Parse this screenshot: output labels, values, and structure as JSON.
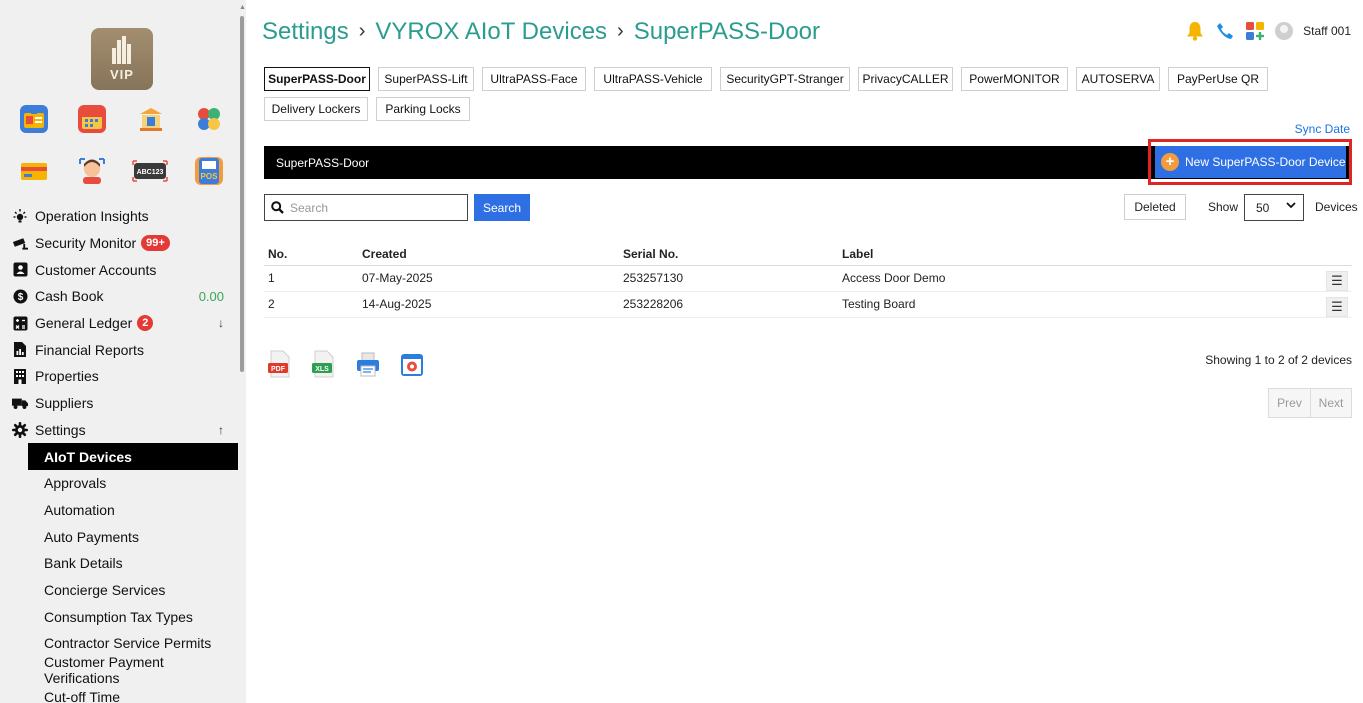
{
  "sidebar": {
    "logo_text": "VIP",
    "app_icons": [
      "id-card-icon",
      "calendar-icon",
      "building-icon",
      "puzzle-icon",
      "wallet-icon",
      "person-face-icon",
      "plate-recognition-icon",
      "pos-icon"
    ],
    "plate_icon_text": "ABC123",
    "pos_icon_text": "POS",
    "nav": [
      {
        "label": "Operation Insights",
        "icon": "bulb-icon"
      },
      {
        "label": "Security Monitor",
        "icon": "cctv-icon",
        "badge": "99+"
      },
      {
        "label": "Customer Accounts",
        "icon": "contact-card-icon"
      },
      {
        "label": "Cash Book",
        "icon": "dollar-circle-icon",
        "value": "0.00"
      },
      {
        "label": "General Ledger",
        "icon": "calculator-icon",
        "badge": "2",
        "arrow": "↓"
      },
      {
        "label": "Financial Reports",
        "icon": "report-icon"
      },
      {
        "label": "Properties",
        "icon": "building-small-icon"
      },
      {
        "label": "Suppliers",
        "icon": "truck-icon"
      },
      {
        "label": "Settings",
        "icon": "gear-icon",
        "arrow": "↑"
      }
    ],
    "settings_sub": [
      "AIoT Devices",
      "Approvals",
      "Automation",
      "Auto Payments",
      "Bank Details",
      "Concierge Services",
      "Consumption Tax Types",
      "Contractor Service Permits",
      "Customer Payment Verifications",
      "Cut-off Time"
    ],
    "active_sub": "AIoT Devices"
  },
  "header": {
    "crumbs": [
      "Settings",
      "VYROX AIoT Devices",
      "SuperPASS-Door"
    ],
    "separator": "›",
    "user": "Staff 001"
  },
  "tabs": [
    "SuperPASS-Door",
    "SuperPASS-Lift",
    "UltraPASS-Face",
    "UltraPASS-Vehicle",
    "SecurityGPT-Stranger",
    "PrivacyCALLER",
    "PowerMONITOR",
    "AUTOSERVA",
    "PayPerUse QR",
    "Delivery Lockers",
    "Parking Locks"
  ],
  "active_tab": "SuperPASS-Door",
  "sync_date": "Sync Date",
  "section_title": "SuperPASS-Door",
  "new_button": "New SuperPASS-Door Device",
  "search": {
    "placeholder": "Search",
    "button": "Search"
  },
  "deleted_label": "Deleted",
  "show_label": "Show",
  "show_value": "50",
  "devices_label": "Devices",
  "table": {
    "headers": [
      "No.",
      "Created",
      "Serial No.",
      "Label"
    ],
    "rows": [
      [
        "1",
        "07-May-2025",
        "253257130",
        "Access Door Demo"
      ],
      [
        "2",
        "14-Aug-2025",
        "253228206",
        "Testing Board"
      ]
    ]
  },
  "export_icons": [
    "pdf-icon",
    "xls-icon",
    "print-icon",
    "settings-export-icon"
  ],
  "export_labels": {
    "pdf": "PDF",
    "xls": "XLS"
  },
  "showing_text": "Showing 1 to 2 of 2 devices",
  "pager": {
    "prev": "Prev",
    "next": "Next"
  },
  "colors": {
    "accent_blue": "#2f6fe4",
    "crumb_teal": "#2a9d8f",
    "highlight_red": "#e02424",
    "badge_red": "#e53935"
  }
}
